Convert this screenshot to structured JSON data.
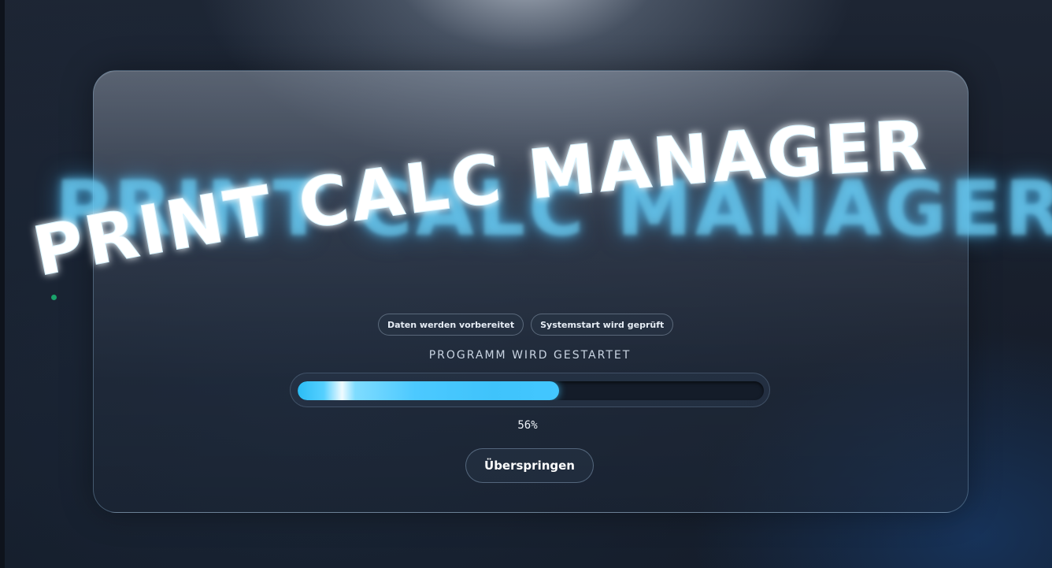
{
  "app": {
    "title": "PRINT CALC MANAGER"
  },
  "loading": {
    "chips": [
      "Daten werden vorbereitet",
      "Systemstart wird geprüft"
    ],
    "status_text": "PROGRAMM WIRD GESTARTET",
    "progress_fraction": 0.56,
    "progress_label": "56%",
    "skip_label": "Überspringen"
  },
  "colors": {
    "accent": "#43c7ff",
    "glow": "#5ac8fa",
    "background": "#171e2b",
    "status_dot": "#1aa36b"
  }
}
